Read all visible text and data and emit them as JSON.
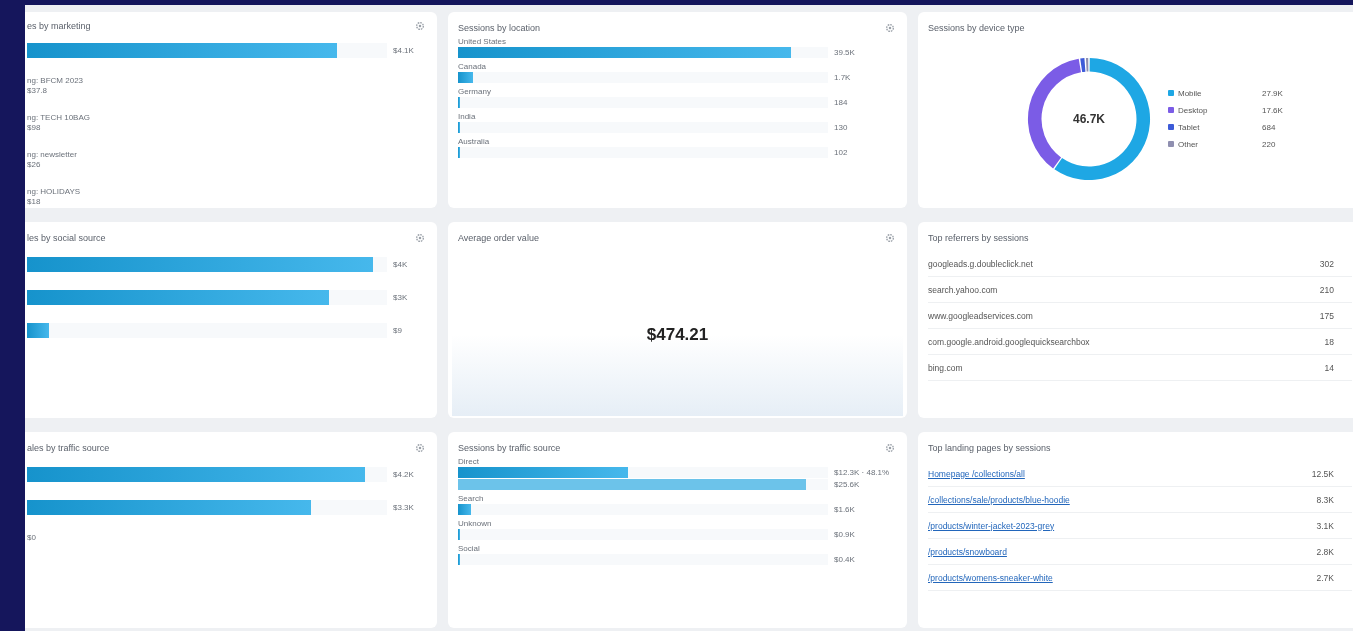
{
  "cards": [
    {
      "kind": "bars",
      "title": "es by marketing",
      "settings_icon": true,
      "rows": [
        {
          "label": "",
          "level": 0.86,
          "value": "$4.1K"
        },
        {
          "label": "ng: BFCM 2023",
          "value": "$37.8"
        },
        {
          "label": "ng: TECH 10BAG",
          "value": "$98"
        },
        {
          "label": "ng: newsletter",
          "value": "$26"
        },
        {
          "label": "ng: HOLIDAYS",
          "value": "$18"
        }
      ]
    },
    {
      "kind": "bars",
      "title": "Sessions by location",
      "settings_icon": true,
      "rows": [
        {
          "label": "United States",
          "level": 0.9,
          "value": "39.5K"
        },
        {
          "label": "Canada",
          "level": 0.04,
          "value": "1.7K"
        },
        {
          "label": "Germany",
          "level": 0.004,
          "value": "184"
        },
        {
          "label": "India",
          "level": 0.003,
          "value": "130"
        },
        {
          "label": "Australia",
          "level": 0.003,
          "value": "102"
        }
      ]
    },
    {
      "kind": "donut",
      "title": "Sessions by device type",
      "total": "46.7K",
      "chart_data": {
        "type": "donut",
        "categories": [
          "Mobile",
          "Desktop",
          "Tablet",
          "Other"
        ],
        "values": [
          59.8,
          37.7,
          1.5,
          1.0
        ]
      },
      "legend": [
        {
          "value": "27.9K",
          "color": "#1ea7e4"
        },
        {
          "value": "17.6K",
          "color": "#7b5ce6"
        },
        {
          "value": "684",
          "color": "#3d5bd8"
        },
        {
          "value": "220",
          "color": "#8f8fb0"
        }
      ]
    },
    {
      "kind": "bars",
      "title": "les by social source",
      "settings_icon": true,
      "rows": [
        {
          "label": "",
          "level": 0.96,
          "value": "$4K"
        },
        {
          "label": "",
          "level": 0.84,
          "value": "$3K"
        },
        {
          "label": "",
          "level": 0.06,
          "value": "$9"
        }
      ]
    },
    {
      "kind": "metric",
      "title": "Average order value",
      "settings_icon": true,
      "value": "$474.21"
    },
    {
      "kind": "table",
      "title": "Top referrers by sessions",
      "rows": [
        {
          "label": "googleads.g.doubleclick.net",
          "value": "302"
        },
        {
          "label": "search.yahoo.com",
          "value": "210"
        },
        {
          "label": "www.googleadservices.com",
          "value": "175"
        },
        {
          "label": "com.google.android.googlequicksearchbox",
          "value": "18"
        },
        {
          "label": "bing.com",
          "value": "14"
        }
      ]
    },
    {
      "kind": "bars",
      "title": "ales by traffic source",
      "settings_icon": true,
      "rows": [
        {
          "label": "",
          "level": 0.94,
          "value": "$4.2K"
        },
        {
          "label": "",
          "level": 0.79,
          "value": "$3.3K"
        },
        {
          "label": "",
          "value": "$0"
        }
      ]
    },
    {
      "kind": "grouped_bars",
      "title": "Sessions by traffic source",
      "settings_icon": true,
      "groups": [
        {
          "label": "Direct",
          "bars": [
            {
              "kind": "current",
              "level": 0.46,
              "value": "$12.3K · 48.1%"
            },
            {
              "kind": "previous",
              "level": 0.94,
              "value": "$25.6K"
            }
          ]
        },
        {
          "label": "Search",
          "bars": [
            {
              "kind": "current",
              "level": 0.035,
              "value": "$1.6K"
            }
          ]
        },
        {
          "label": "Unknown",
          "bars": [
            {
              "kind": "current",
              "level": 0.003,
              "value": "$0.9K"
            }
          ]
        },
        {
          "label": "Social",
          "bars": [
            {
              "kind": "current",
              "level": 0.003,
              "value": "$0.4K"
            }
          ]
        }
      ]
    },
    {
      "kind": "table",
      "title": "Top landing pages by sessions",
      "rows": [
        {
          "label": "Homepage /collections/all",
          "value": "12.5K",
          "link": true
        },
        {
          "label": "/collections/sale/products/blue-hoodie",
          "value": "8.3K",
          "link": true
        },
        {
          "label": "/products/winter-jacket-2023-grey",
          "value": "3.1K",
          "link": true
        },
        {
          "label": "/products/snowboard",
          "value": "2.8K",
          "link": true
        },
        {
          "label": "/products/womens-sneaker-white",
          "value": "2.7K",
          "link": true
        }
      ]
    }
  ]
}
